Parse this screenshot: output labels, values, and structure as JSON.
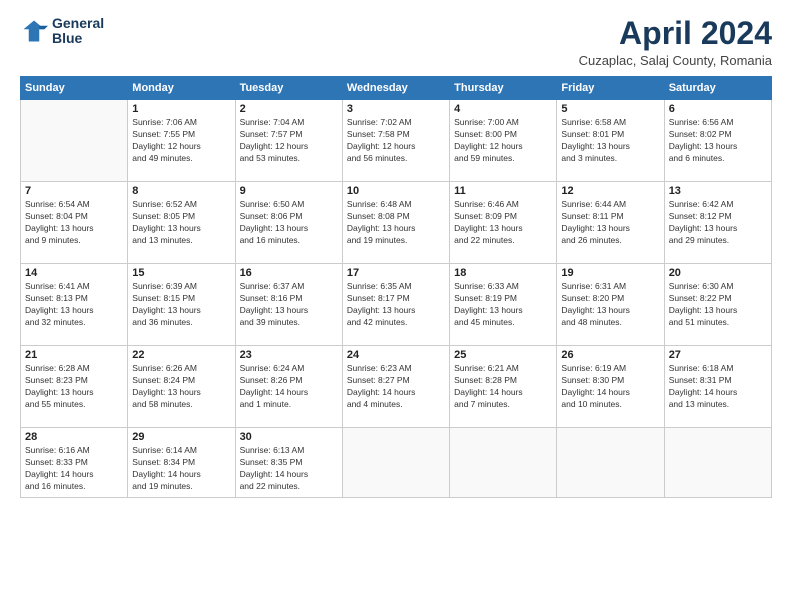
{
  "header": {
    "logo_line1": "General",
    "logo_line2": "Blue",
    "title": "April 2024",
    "subtitle": "Cuzaplac, Salaj County, Romania"
  },
  "weekdays": [
    "Sunday",
    "Monday",
    "Tuesday",
    "Wednesday",
    "Thursday",
    "Friday",
    "Saturday"
  ],
  "weeks": [
    [
      {
        "day": "",
        "info": ""
      },
      {
        "day": "1",
        "info": "Sunrise: 7:06 AM\nSunset: 7:55 PM\nDaylight: 12 hours\nand 49 minutes."
      },
      {
        "day": "2",
        "info": "Sunrise: 7:04 AM\nSunset: 7:57 PM\nDaylight: 12 hours\nand 53 minutes."
      },
      {
        "day": "3",
        "info": "Sunrise: 7:02 AM\nSunset: 7:58 PM\nDaylight: 12 hours\nand 56 minutes."
      },
      {
        "day": "4",
        "info": "Sunrise: 7:00 AM\nSunset: 8:00 PM\nDaylight: 12 hours\nand 59 minutes."
      },
      {
        "day": "5",
        "info": "Sunrise: 6:58 AM\nSunset: 8:01 PM\nDaylight: 13 hours\nand 3 minutes."
      },
      {
        "day": "6",
        "info": "Sunrise: 6:56 AM\nSunset: 8:02 PM\nDaylight: 13 hours\nand 6 minutes."
      }
    ],
    [
      {
        "day": "7",
        "info": "Sunrise: 6:54 AM\nSunset: 8:04 PM\nDaylight: 13 hours\nand 9 minutes."
      },
      {
        "day": "8",
        "info": "Sunrise: 6:52 AM\nSunset: 8:05 PM\nDaylight: 13 hours\nand 13 minutes."
      },
      {
        "day": "9",
        "info": "Sunrise: 6:50 AM\nSunset: 8:06 PM\nDaylight: 13 hours\nand 16 minutes."
      },
      {
        "day": "10",
        "info": "Sunrise: 6:48 AM\nSunset: 8:08 PM\nDaylight: 13 hours\nand 19 minutes."
      },
      {
        "day": "11",
        "info": "Sunrise: 6:46 AM\nSunset: 8:09 PM\nDaylight: 13 hours\nand 22 minutes."
      },
      {
        "day": "12",
        "info": "Sunrise: 6:44 AM\nSunset: 8:11 PM\nDaylight: 13 hours\nand 26 minutes."
      },
      {
        "day": "13",
        "info": "Sunrise: 6:42 AM\nSunset: 8:12 PM\nDaylight: 13 hours\nand 29 minutes."
      }
    ],
    [
      {
        "day": "14",
        "info": "Sunrise: 6:41 AM\nSunset: 8:13 PM\nDaylight: 13 hours\nand 32 minutes."
      },
      {
        "day": "15",
        "info": "Sunrise: 6:39 AM\nSunset: 8:15 PM\nDaylight: 13 hours\nand 36 minutes."
      },
      {
        "day": "16",
        "info": "Sunrise: 6:37 AM\nSunset: 8:16 PM\nDaylight: 13 hours\nand 39 minutes."
      },
      {
        "day": "17",
        "info": "Sunrise: 6:35 AM\nSunset: 8:17 PM\nDaylight: 13 hours\nand 42 minutes."
      },
      {
        "day": "18",
        "info": "Sunrise: 6:33 AM\nSunset: 8:19 PM\nDaylight: 13 hours\nand 45 minutes."
      },
      {
        "day": "19",
        "info": "Sunrise: 6:31 AM\nSunset: 8:20 PM\nDaylight: 13 hours\nand 48 minutes."
      },
      {
        "day": "20",
        "info": "Sunrise: 6:30 AM\nSunset: 8:22 PM\nDaylight: 13 hours\nand 51 minutes."
      }
    ],
    [
      {
        "day": "21",
        "info": "Sunrise: 6:28 AM\nSunset: 8:23 PM\nDaylight: 13 hours\nand 55 minutes."
      },
      {
        "day": "22",
        "info": "Sunrise: 6:26 AM\nSunset: 8:24 PM\nDaylight: 13 hours\nand 58 minutes."
      },
      {
        "day": "23",
        "info": "Sunrise: 6:24 AM\nSunset: 8:26 PM\nDaylight: 14 hours\nand 1 minute."
      },
      {
        "day": "24",
        "info": "Sunrise: 6:23 AM\nSunset: 8:27 PM\nDaylight: 14 hours\nand 4 minutes."
      },
      {
        "day": "25",
        "info": "Sunrise: 6:21 AM\nSunset: 8:28 PM\nDaylight: 14 hours\nand 7 minutes."
      },
      {
        "day": "26",
        "info": "Sunrise: 6:19 AM\nSunset: 8:30 PM\nDaylight: 14 hours\nand 10 minutes."
      },
      {
        "day": "27",
        "info": "Sunrise: 6:18 AM\nSunset: 8:31 PM\nDaylight: 14 hours\nand 13 minutes."
      }
    ],
    [
      {
        "day": "28",
        "info": "Sunrise: 6:16 AM\nSunset: 8:33 PM\nDaylight: 14 hours\nand 16 minutes."
      },
      {
        "day": "29",
        "info": "Sunrise: 6:14 AM\nSunset: 8:34 PM\nDaylight: 14 hours\nand 19 minutes."
      },
      {
        "day": "30",
        "info": "Sunrise: 6:13 AM\nSunset: 8:35 PM\nDaylight: 14 hours\nand 22 minutes."
      },
      {
        "day": "",
        "info": ""
      },
      {
        "day": "",
        "info": ""
      },
      {
        "day": "",
        "info": ""
      },
      {
        "day": "",
        "info": ""
      }
    ]
  ]
}
